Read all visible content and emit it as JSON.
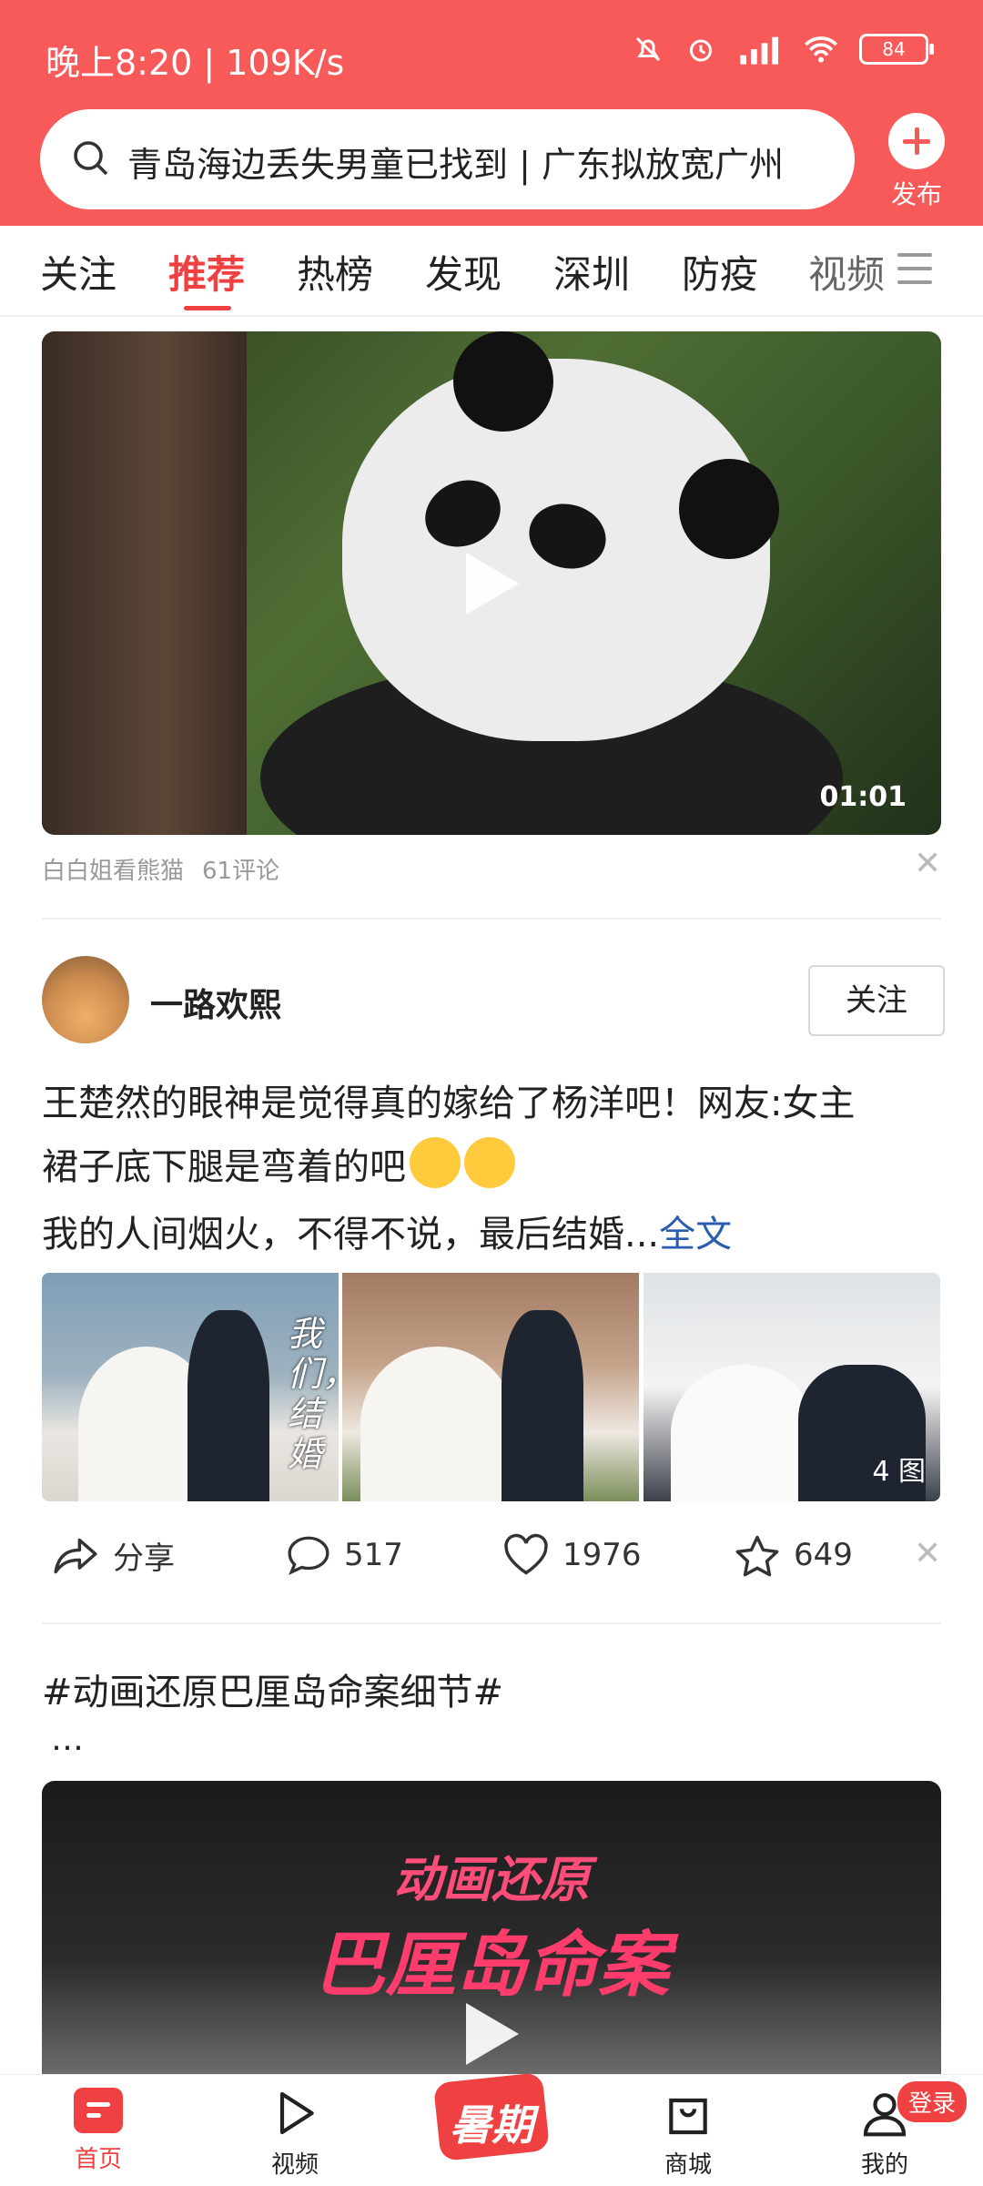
{
  "status_bar": {
    "time": "晚上8:20 | 109K/s",
    "battery": "84"
  },
  "search": {
    "text": "青岛海边丢失男童已找到 | 广东拟放宽广州"
  },
  "publish": {
    "label": "发布"
  },
  "tabs": [
    {
      "label": "关注"
    },
    {
      "label": "推荐",
      "active": true
    },
    {
      "label": "热榜"
    },
    {
      "label": "发现"
    },
    {
      "label": "深圳"
    },
    {
      "label": "防疫"
    },
    {
      "label": "视频"
    }
  ],
  "video_card": {
    "duration": "01:01",
    "source": "白白姐看熊猫",
    "comments": "61评论"
  },
  "post": {
    "author": "一路欢熙",
    "follow_label": "关注",
    "line1": "王楚然的眼神是觉得真的嫁给了杨洋吧！网友:女主",
    "line2": "裙子底下腿是弯着的吧",
    "line3": "我的人间烟火，不得不说，最后结婚...",
    "full_text_link": "全文",
    "photo_overlay_text": "我们，结婚",
    "image_count": "4 图",
    "actions": {
      "share": "分享",
      "comments": "517",
      "likes": "1976",
      "favorites": "649"
    }
  },
  "topic_post": {
    "title": "#动画还原巴厘岛命案细节#",
    "ellipsis": "…",
    "video_title_line1": "动画还原",
    "video_title_line2": "巴厘岛命案"
  },
  "bottom_nav": {
    "home": "首页",
    "video": "视频",
    "promo": "暑期",
    "mall": "商城",
    "mine": "我的",
    "login_badge": "登录"
  },
  "colors": {
    "brand_red": "#f85959",
    "active_red": "#f04142",
    "link_blue": "#2a5db0"
  }
}
